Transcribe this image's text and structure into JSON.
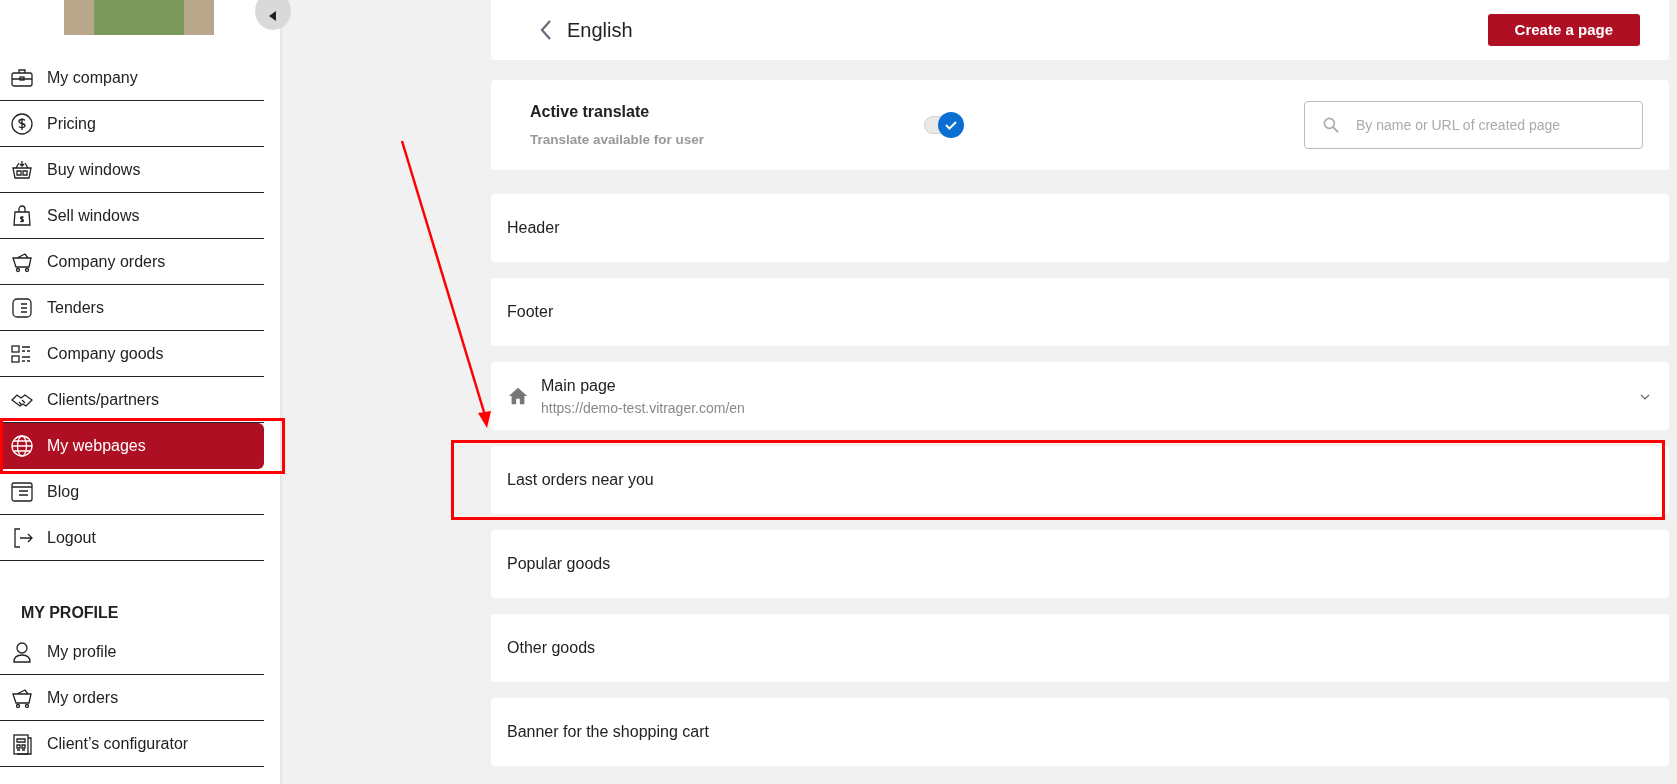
{
  "sidebar": {
    "items": [
      {
        "label": "My company",
        "selected": false,
        "highlighted": false
      },
      {
        "label": "Pricing",
        "selected": false,
        "highlighted": false
      },
      {
        "label": "Buy windows",
        "selected": false,
        "highlighted": false
      },
      {
        "label": "Sell windows",
        "selected": false,
        "highlighted": false
      },
      {
        "label": "Company orders",
        "selected": false,
        "highlighted": false
      },
      {
        "label": "Tenders",
        "selected": false,
        "highlighted": false
      },
      {
        "label": "Company goods",
        "selected": false,
        "highlighted": false
      },
      {
        "label": "Clients/partners",
        "selected": false,
        "highlighted": false
      },
      {
        "label": "My webpages",
        "selected": true,
        "highlighted": true
      },
      {
        "label": "Blog",
        "selected": false,
        "highlighted": false
      },
      {
        "label": "Logout",
        "selected": false,
        "highlighted": false
      }
    ],
    "profile_heading": "MY PROFILE",
    "profile_items": [
      {
        "label": "My profile",
        "selected": false
      },
      {
        "label": "My orders",
        "selected": false
      },
      {
        "label": "Client’s configurator",
        "selected": false
      }
    ]
  },
  "header": {
    "title": "English",
    "button": "Create a page"
  },
  "translate": {
    "title": "Active translate",
    "subtitle": "Translate available for user",
    "on": true,
    "search": {
      "placeholder": "By name or URL of created page"
    }
  },
  "rows": [
    {
      "kind": "plain",
      "label": "Header",
      "highlighted": false
    },
    {
      "kind": "plain",
      "label": "Footer",
      "highlighted": false
    },
    {
      "kind": "page",
      "label": "Main page",
      "url": "https://demo-test.vitrager.com/en",
      "highlighted": false
    },
    {
      "kind": "plain",
      "label": "Last orders near you",
      "highlighted": true
    },
    {
      "kind": "plain",
      "label": "Popular goods",
      "highlighted": false
    },
    {
      "kind": "plain",
      "label": "Other goods",
      "highlighted": false
    },
    {
      "kind": "plain",
      "label": "Banner for the shopping cart",
      "highlighted": false
    }
  ]
}
